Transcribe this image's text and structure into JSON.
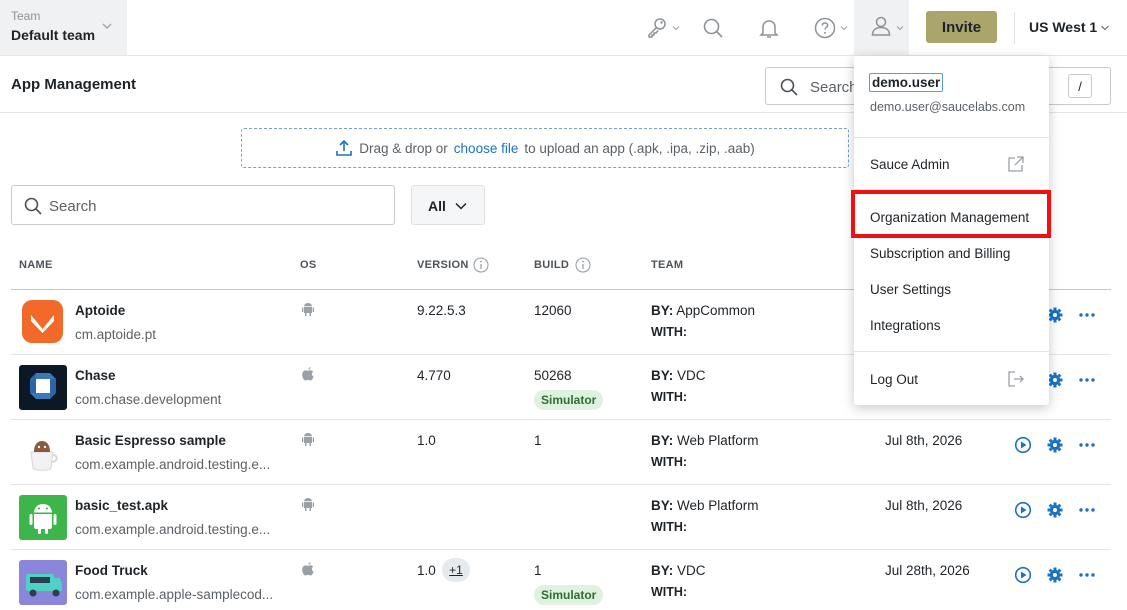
{
  "team": {
    "label": "Team",
    "name": "Default team"
  },
  "topbar": {
    "invite_label": "Invite",
    "region": "US West 1"
  },
  "page": {
    "title": "App Management",
    "search_placeholder": "Search",
    "search_shortcut": "/"
  },
  "upload": {
    "text_before": "Drag & drop or",
    "link": "choose file",
    "text_after": "to upload an app (.apk, .ipa, .zip, .aab)"
  },
  "filters": {
    "search_placeholder": "Search",
    "os_filter": "All"
  },
  "table": {
    "headers": {
      "name": "NAME",
      "os": "OS",
      "version": "VERSION",
      "build": "BUILD",
      "team": "TEAM"
    },
    "by_label": "BY:",
    "with_label": "WITH:",
    "rows": [
      {
        "name": "Aptoide",
        "package": "cm.aptoide.pt",
        "os": "android",
        "version": "9.22.5.3",
        "build": "12060",
        "by": "AppCommon",
        "date": "",
        "simulator": "",
        "version_more": "",
        "icon": "aptoide-icon"
      },
      {
        "name": "Chase",
        "package": "com.chase.development",
        "os": "apple",
        "version": "4.770",
        "build": "50268",
        "by": "VDC",
        "date": "",
        "simulator": "Simulator",
        "version_more": "",
        "icon": "chase-icon"
      },
      {
        "name": "Basic Espresso sample",
        "package": "com.example.android.testing.e...",
        "os": "android",
        "version": "1.0",
        "build": "1",
        "by": "Web Platform",
        "date": "Jul 8th, 2026",
        "simulator": "",
        "version_more": "",
        "icon": "espresso-icon"
      },
      {
        "name": "basic_test.apk",
        "package": "com.example.android.testing.e...",
        "os": "android",
        "version": "",
        "build": "",
        "by": "Web Platform",
        "date": "Jul 8th, 2026",
        "simulator": "",
        "version_more": "",
        "icon": "android-robot-icon"
      },
      {
        "name": "Food Truck",
        "package": "com.example.apple-samplecod...",
        "os": "apple",
        "version": "1.0",
        "build": "1",
        "by": "VDC",
        "date": "Jul 28th, 2026",
        "simulator": "Simulator",
        "version_more": "+1",
        "icon": "food-truck-icon"
      }
    ]
  },
  "user_menu": {
    "username": "demo.user",
    "email": "demo.user@saucelabs.com",
    "items": [
      "Sauce Admin",
      "Organization Management",
      "Subscription and Billing",
      "User Settings",
      "Integrations",
      "Log Out"
    ]
  },
  "colors": {
    "accent": "#1a72c7",
    "invite": "#aaa66b",
    "highlight": "#ee1111",
    "simulator_bg": "#dff1df"
  }
}
